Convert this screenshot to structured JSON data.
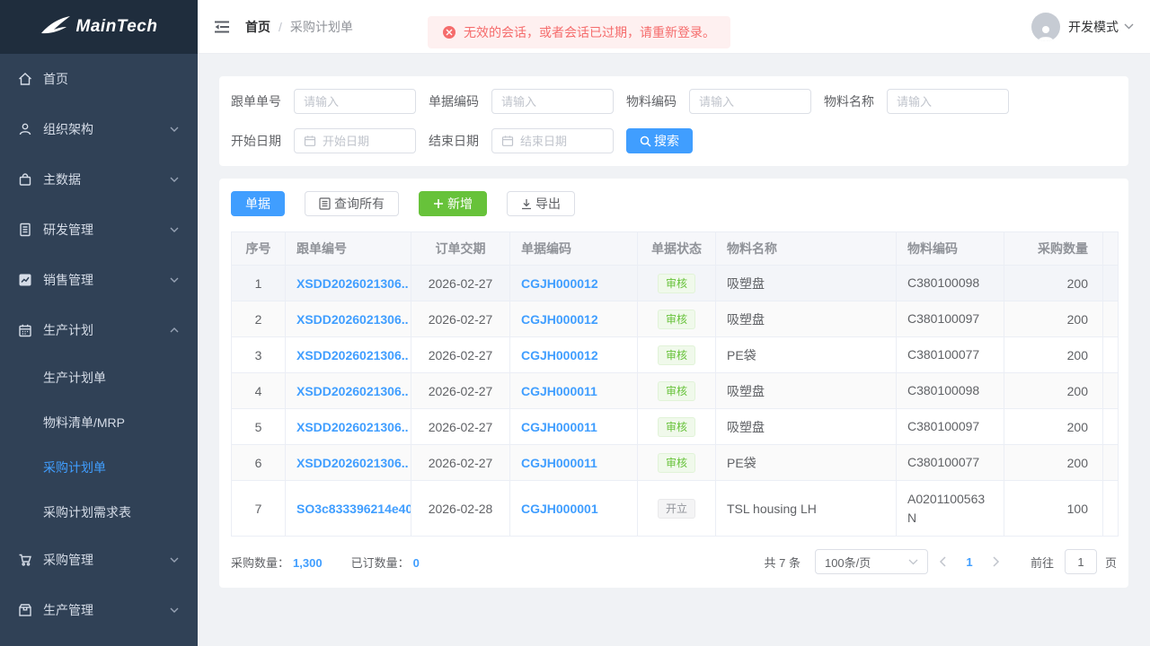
{
  "brand": {
    "name": "MainTech"
  },
  "colors": {
    "accent": "#409eff",
    "success": "#67c23a",
    "danger": "#f56c6c",
    "sidebar_bg": "#304156",
    "sidebar_logo_bg": "#1f2d3d",
    "stripe_bg": "#fafafa"
  },
  "sidebar": {
    "items": [
      {
        "label": "首页",
        "icon": "home-icon",
        "chevron": null,
        "children": []
      },
      {
        "label": "组织架构",
        "icon": "user-icon",
        "chevron": "down",
        "children": []
      },
      {
        "label": "主数据",
        "icon": "bag-icon",
        "chevron": "down",
        "children": []
      },
      {
        "label": "研发管理",
        "icon": "document-icon",
        "chevron": "down",
        "children": []
      },
      {
        "label": "销售管理",
        "icon": "chart-icon",
        "chevron": "down",
        "children": []
      },
      {
        "label": "生产计划",
        "icon": "calendar-icon",
        "chevron": "up",
        "children": [
          {
            "label": "生产计划单",
            "active": false
          },
          {
            "label": "物料清单/MRP",
            "active": false
          },
          {
            "label": "采购计划单",
            "active": true
          },
          {
            "label": "采购计划需求表",
            "active": false
          }
        ]
      },
      {
        "label": "采购管理",
        "icon": "cart-icon",
        "chevron": "down",
        "children": []
      },
      {
        "label": "生产管理",
        "icon": "box-icon",
        "chevron": "down",
        "children": []
      }
    ]
  },
  "topbar": {
    "breadcrumb": {
      "root": "首页",
      "separator": "/",
      "current": "采购计划单"
    },
    "alert": {
      "text": "无效的会话，或者会话已过期，请重新登录。",
      "icon": "error-circle-icon"
    },
    "user": {
      "name": "开发模式",
      "icon": "avatar-icon"
    }
  },
  "filters": {
    "row1": [
      {
        "label": "跟单单号",
        "placeholder": "请输入",
        "type": "text"
      },
      {
        "label": "单据编码",
        "placeholder": "请输入",
        "type": "text"
      },
      {
        "label": "物料编码",
        "placeholder": "请输入",
        "type": "text"
      },
      {
        "label": "物料名称",
        "placeholder": "请输入",
        "type": "text"
      }
    ],
    "row2": [
      {
        "label": "开始日期",
        "placeholder": "开始日期",
        "type": "date"
      },
      {
        "label": "结束日期",
        "placeholder": "结束日期",
        "type": "date"
      }
    ],
    "search_label": "搜索"
  },
  "toolbar": {
    "danju_label": "单据",
    "query_all_label": "查询所有",
    "add_label": "新增",
    "export_label": "导出"
  },
  "table": {
    "columns": [
      "序号",
      "跟单编号",
      "订单交期",
      "单据编码",
      "单据状态",
      "物料名称",
      "物料编码",
      "采购数量"
    ],
    "rows": [
      {
        "index": "1",
        "order_no": "XSDD2026021306..",
        "due_date": "2026-02-27",
        "doc_no": "CGJH000012",
        "status": "审核",
        "status_type": "success",
        "material_name": "吸塑盘",
        "material_code": "C380100098",
        "qty": "200",
        "hovered": true
      },
      {
        "index": "2",
        "order_no": "XSDD2026021306..",
        "due_date": "2026-02-27",
        "doc_no": "CGJH000012",
        "status": "审核",
        "status_type": "success",
        "material_name": "吸塑盘",
        "material_code": "C380100097",
        "qty": "200",
        "hovered": false
      },
      {
        "index": "3",
        "order_no": "XSDD2026021306..",
        "due_date": "2026-02-27",
        "doc_no": "CGJH000012",
        "status": "审核",
        "status_type": "success",
        "material_name": "PE袋",
        "material_code": "C380100077",
        "qty": "200",
        "hovered": false
      },
      {
        "index": "4",
        "order_no": "XSDD2026021306..",
        "due_date": "2026-02-27",
        "doc_no": "CGJH000011",
        "status": "审核",
        "status_type": "success",
        "material_name": "吸塑盘",
        "material_code": "C380100098",
        "qty": "200",
        "hovered": false
      },
      {
        "index": "5",
        "order_no": "XSDD2026021306..",
        "due_date": "2026-02-27",
        "doc_no": "CGJH000011",
        "status": "审核",
        "status_type": "success",
        "material_name": "吸塑盘",
        "material_code": "C380100097",
        "qty": "200",
        "hovered": false
      },
      {
        "index": "6",
        "order_no": "XSDD2026021306..",
        "due_date": "2026-02-27",
        "doc_no": "CGJH000011",
        "status": "审核",
        "status_type": "success",
        "material_name": "PE袋",
        "material_code": "C380100077",
        "qty": "200",
        "hovered": false
      },
      {
        "index": "7",
        "order_no": "SO3c833396214e40",
        "due_date": "2026-02-28",
        "doc_no": "CGJH000001",
        "status": "开立",
        "status_type": "info",
        "material_name": "TSL housing LH",
        "material_code": "A0201100563N",
        "qty": "100",
        "hovered": false
      }
    ]
  },
  "summary": {
    "purchase_label": "采购数量：",
    "purchase_value": "1,300",
    "ordered_label": "已订数量：",
    "ordered_value": "0"
  },
  "pagination": {
    "total_text": "共 7 条",
    "page_size_text": "100条/页",
    "current_page": "1",
    "goto_label": "前往",
    "goto_value": "1",
    "page_unit": "页"
  }
}
